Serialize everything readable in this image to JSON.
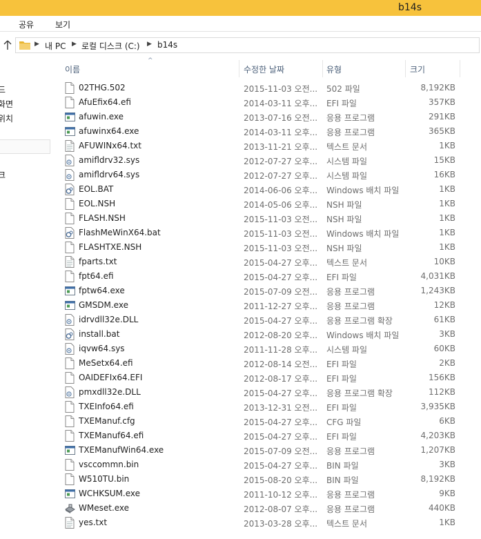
{
  "window": {
    "title": "b14s",
    "title_fragment": "'"
  },
  "ribbon": {
    "tabs": [
      "공유",
      "보기"
    ]
  },
  "address": {
    "crumbs": [
      "내 PC",
      "로컬 디스크 (C:)",
      "b14s"
    ]
  },
  "nav": {
    "items": [
      "|",
      "드",
      "화면",
      "위치",
      "",
      "크"
    ]
  },
  "columns": {
    "name": "이름",
    "date": "수정한 날짜",
    "type": "유형",
    "size": "크기"
  },
  "files": [
    {
      "name": "02THG.502",
      "date": "2015-11-03 오전...",
      "type": "502 파일",
      "size": "8,192KB",
      "icon": "file-icon"
    },
    {
      "name": "AfuEfix64.efi",
      "date": "2014-03-11 오후...",
      "type": "EFI 파일",
      "size": "357KB",
      "icon": "file-icon"
    },
    {
      "name": "afuwin.exe",
      "date": "2013-07-16 오전...",
      "type": "응용 프로그램",
      "size": "291KB",
      "icon": "exe-icon"
    },
    {
      "name": "afuwinx64.exe",
      "date": "2014-03-11 오후...",
      "type": "응용 프로그램",
      "size": "365KB",
      "icon": "exe-icon"
    },
    {
      "name": "AFUWINx64.txt",
      "date": "2013-11-21 오후...",
      "type": "텍스트 문서",
      "size": "1KB",
      "icon": "text-icon"
    },
    {
      "name": "amifldrv32.sys",
      "date": "2012-07-27 오후...",
      "type": "시스템 파일",
      "size": "15KB",
      "icon": "gear-file-icon"
    },
    {
      "name": "amifldrv64.sys",
      "date": "2012-07-27 오후...",
      "type": "시스템 파일",
      "size": "16KB",
      "icon": "gear-file-icon"
    },
    {
      "name": "EOL.BAT",
      "date": "2014-06-06 오후...",
      "type": "Windows 배치 파일",
      "size": "1KB",
      "icon": "batch-icon"
    },
    {
      "name": "EOL.NSH",
      "date": "2014-05-06 오후...",
      "type": "NSH 파일",
      "size": "1KB",
      "icon": "file-icon"
    },
    {
      "name": "FLASH.NSH",
      "date": "2015-11-03 오전...",
      "type": "NSH 파일",
      "size": "1KB",
      "icon": "file-icon"
    },
    {
      "name": "FlashMeWinX64.bat",
      "date": "2015-11-03 오전...",
      "type": "Windows 배치 파일",
      "size": "1KB",
      "icon": "batch-icon"
    },
    {
      "name": "FLASHTXE.NSH",
      "date": "2015-11-03 오전...",
      "type": "NSH 파일",
      "size": "1KB",
      "icon": "file-icon"
    },
    {
      "name": "fparts.txt",
      "date": "2015-04-27 오후...",
      "type": "텍스트 문서",
      "size": "10KB",
      "icon": "text-icon"
    },
    {
      "name": "fpt64.efi",
      "date": "2015-04-27 오후...",
      "type": "EFI 파일",
      "size": "4,031KB",
      "icon": "file-icon"
    },
    {
      "name": "fptw64.exe",
      "date": "2015-07-09 오전...",
      "type": "응용 프로그램",
      "size": "1,243KB",
      "icon": "exe-icon"
    },
    {
      "name": "GMSDM.exe",
      "date": "2011-12-27 오후...",
      "type": "응용 프로그램",
      "size": "12KB",
      "icon": "exe-icon"
    },
    {
      "name": "idrvdll32e.DLL",
      "date": "2015-04-27 오후...",
      "type": "응용 프로그램 확장",
      "size": "61KB",
      "icon": "gear-file-icon"
    },
    {
      "name": "install.bat",
      "date": "2012-08-20 오후...",
      "type": "Windows 배치 파일",
      "size": "3KB",
      "icon": "batch-icon"
    },
    {
      "name": "iqvw64.sys",
      "date": "2011-11-28 오후...",
      "type": "시스템 파일",
      "size": "60KB",
      "icon": "gear-file-icon"
    },
    {
      "name": "MeSetx64.efi",
      "date": "2012-08-14 오전...",
      "type": "EFI 파일",
      "size": "2KB",
      "icon": "file-icon"
    },
    {
      "name": "OAIDEFIx64.EFI",
      "date": "2012-08-17 오후...",
      "type": "EFI 파일",
      "size": "156KB",
      "icon": "file-icon"
    },
    {
      "name": "pmxdll32e.DLL",
      "date": "2015-04-27 오후...",
      "type": "응용 프로그램 확장",
      "size": "112KB",
      "icon": "gear-file-icon"
    },
    {
      "name": "TXEInfo64.efi",
      "date": "2013-12-31 오전...",
      "type": "EFI 파일",
      "size": "3,935KB",
      "icon": "file-icon"
    },
    {
      "name": "TXEManuf.cfg",
      "date": "2015-04-27 오후...",
      "type": "CFG 파일",
      "size": "6KB",
      "icon": "file-icon"
    },
    {
      "name": "TXEManuf64.efi",
      "date": "2015-04-27 오후...",
      "type": "EFI 파일",
      "size": "4,203KB",
      "icon": "file-icon"
    },
    {
      "name": "TXEManufWin64.exe",
      "date": "2015-07-09 오전...",
      "type": "응용 프로그램",
      "size": "1,207KB",
      "icon": "exe-icon"
    },
    {
      "name": "vsccommn.bin",
      "date": "2015-04-27 오후...",
      "type": "BIN 파일",
      "size": "3KB",
      "icon": "file-icon"
    },
    {
      "name": "W510TU.bin",
      "date": "2015-08-20 오후...",
      "type": "BIN 파일",
      "size": "8,192KB",
      "icon": "file-icon"
    },
    {
      "name": "WCHKSUM.exe",
      "date": "2011-10-12 오후...",
      "type": "응용 프로그램",
      "size": "9KB",
      "icon": "exe-icon"
    },
    {
      "name": "WMeset.exe",
      "date": "2012-08-07 오후...",
      "type": "응용 프로그램",
      "size": "440KB",
      "icon": "installer-icon"
    },
    {
      "name": "yes.txt",
      "date": "2013-03-28 오후...",
      "type": "텍스트 문서",
      "size": "1KB",
      "icon": "text-icon"
    }
  ],
  "colors": {
    "titlebar": "#f7c23c",
    "header_text": "#4c607a",
    "meta_text": "#6d6d6d"
  }
}
